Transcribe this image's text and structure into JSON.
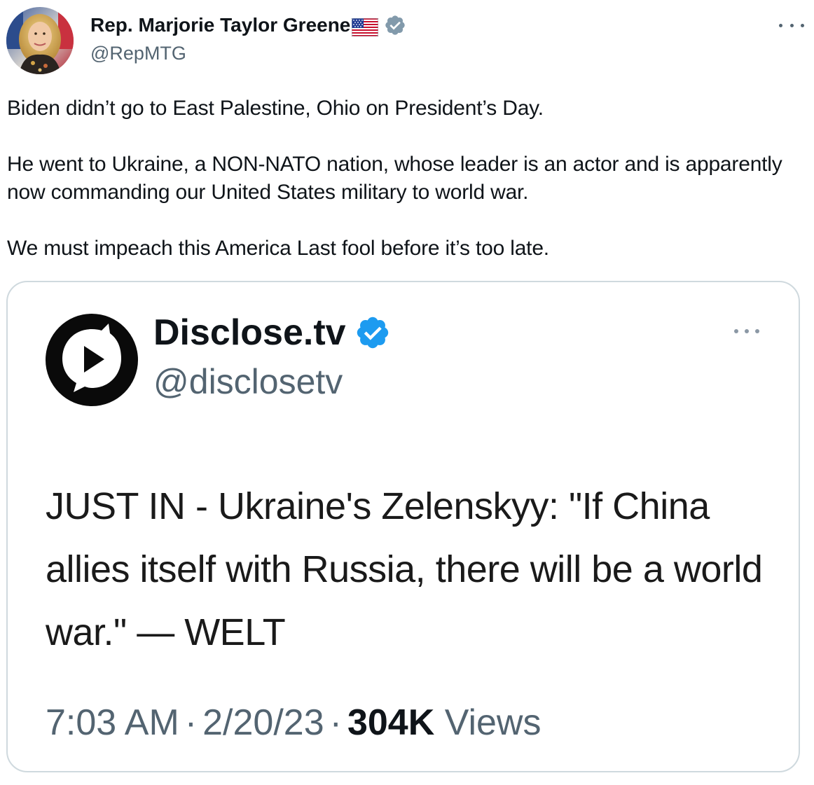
{
  "tweet": {
    "author_name": "Rep. Marjorie Taylor Greene",
    "author_handle": "@RepMTG",
    "paragraphs": [
      "Biden didn’t go to East Palestine, Ohio on President’s Day.",
      "He went to Ukraine, a NON-NATO nation, whose leader is an actor and is apparently now commanding our United States military to world war.",
      "We must impeach this America Last fool before it’s too late."
    ]
  },
  "embedded": {
    "author_name": "Disclose.tv",
    "author_handle": "@disclosetv",
    "text": "JUST IN - Ukraine's Zelenskyy: \"If China allies itself with Russia, there will be a world war.\" — WELT",
    "time": "7:03 AM",
    "separator": "·",
    "date": "2/20/23",
    "views_count": "304K",
    "views_label": "Views"
  },
  "icons": {
    "flag": "us-flag-icon",
    "verified": "verified-badge-icon",
    "more": "more-options-icon",
    "logo": "disclosetv-logo-icon"
  },
  "colors": {
    "verified_blue": "#1d9bf0",
    "secondary_text": "#536471",
    "primary_text": "#0f1419",
    "card_border": "#cfd9de"
  }
}
